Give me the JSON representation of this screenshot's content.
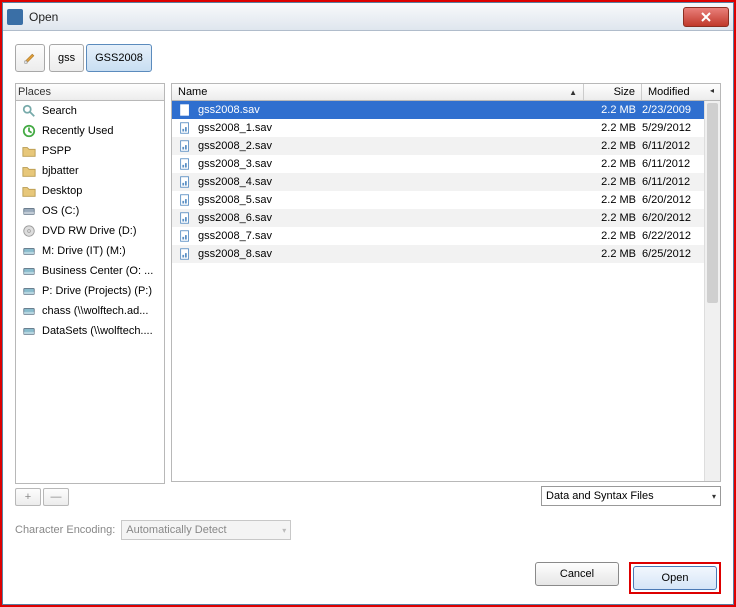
{
  "window": {
    "title": "Open"
  },
  "path": {
    "segments": [
      "gss",
      "GSS2008"
    ],
    "active_index": 1
  },
  "places": {
    "header": "Places",
    "items": [
      {
        "label": "Search",
        "icon": "search"
      },
      {
        "label": "Recently Used",
        "icon": "recent"
      },
      {
        "label": "PSPP",
        "icon": "folder"
      },
      {
        "label": "bjbatter",
        "icon": "folder"
      },
      {
        "label": "Desktop",
        "icon": "folder"
      },
      {
        "label": "OS (C:)",
        "icon": "drive"
      },
      {
        "label": "DVD RW Drive (D:)",
        "icon": "dvd"
      },
      {
        "label": "M: Drive (IT) (M:)",
        "icon": "netdrive"
      },
      {
        "label": "Business Center (O: ...",
        "icon": "netdrive"
      },
      {
        "label": "P: Drive (Projects) (P:)",
        "icon": "netdrive"
      },
      {
        "label": "chass (\\\\wolftech.ad...",
        "icon": "netdrive"
      },
      {
        "label": "DataSets (\\\\wolftech....",
        "icon": "netdrive"
      }
    ]
  },
  "filelist": {
    "columns": {
      "name": "Name",
      "size": "Size",
      "modified": "Modified"
    },
    "rows": [
      {
        "name": "gss2008.sav",
        "size": "2.2 MB",
        "modified": "2/23/2009",
        "selected": true
      },
      {
        "name": "gss2008_1.sav",
        "size": "2.2 MB",
        "modified": "5/29/2012"
      },
      {
        "name": "gss2008_2.sav",
        "size": "2.2 MB",
        "modified": "6/11/2012"
      },
      {
        "name": "gss2008_3.sav",
        "size": "2.2 MB",
        "modified": "6/11/2012"
      },
      {
        "name": "gss2008_4.sav",
        "size": "2.2 MB",
        "modified": "6/11/2012"
      },
      {
        "name": "gss2008_5.sav",
        "size": "2.2 MB",
        "modified": "6/20/2012"
      },
      {
        "name": "gss2008_6.sav",
        "size": "2.2 MB",
        "modified": "6/20/2012"
      },
      {
        "name": "gss2008_7.sav",
        "size": "2.2 MB",
        "modified": "6/22/2012"
      },
      {
        "name": "gss2008_8.sav",
        "size": "2.2 MB",
        "modified": "6/25/2012"
      }
    ]
  },
  "filetype": {
    "selected": "Data and Syntax Files"
  },
  "encoding": {
    "label": "Character Encoding:",
    "selected": "Automatically Detect"
  },
  "buttons": {
    "cancel": "Cancel",
    "open": "Open"
  },
  "tools": {
    "add": "+",
    "remove": "—"
  }
}
